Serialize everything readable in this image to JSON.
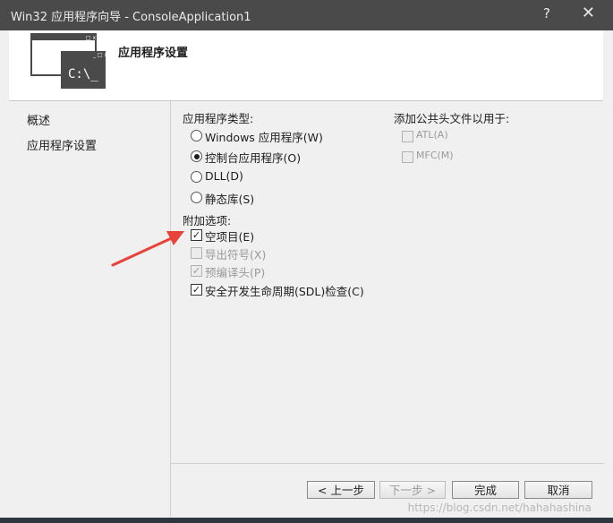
{
  "window": {
    "title": "Win32 应用程序向导 - ConsoleApplication1",
    "help_label": "?",
    "close_label": "✕"
  },
  "header": {
    "title": "应用程序设置",
    "icon_text": "C:\\_",
    "icon_window_controls": "_ □ x"
  },
  "sidebar": {
    "items": [
      {
        "label": "概述"
      },
      {
        "label": "应用程序设置"
      }
    ]
  },
  "app_type": {
    "label": "应用程序类型:",
    "options": [
      {
        "label": "Windows 应用程序(W)",
        "selected": false
      },
      {
        "label": "控制台应用程序(O)",
        "selected": true
      },
      {
        "label": "DLL(D)",
        "selected": false
      },
      {
        "label": "静态库(S)",
        "selected": false
      }
    ]
  },
  "common_headers": {
    "label": "添加公共头文件以用于:",
    "options": [
      {
        "label": "ATL(A)",
        "checked": false,
        "enabled": false
      },
      {
        "label": "MFC(M)",
        "checked": false,
        "enabled": false
      }
    ]
  },
  "extra_options": {
    "label": "附加选项:",
    "options": [
      {
        "label": "空项目(E)",
        "checked": true,
        "enabled": true
      },
      {
        "label": "导出符号(X)",
        "checked": false,
        "enabled": false
      },
      {
        "label": "预编译头(P)",
        "checked": true,
        "enabled": false
      },
      {
        "label": "安全开发生命周期(SDL)检查(C)",
        "checked": true,
        "enabled": true
      }
    ]
  },
  "buttons": {
    "prev": "< 上一步",
    "next": "下一步 >",
    "finish": "完成",
    "cancel": "取消"
  },
  "watermark": "https://blog.csdn.net/hahahashina",
  "colors": {
    "annotation_arrow": "#e8433a",
    "titlebar": "#4a4a4a"
  }
}
